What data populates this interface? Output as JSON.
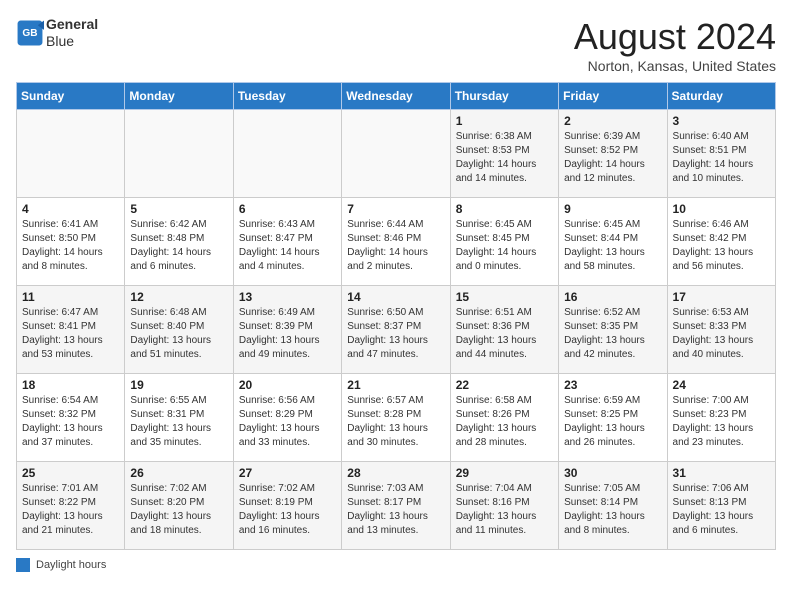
{
  "header": {
    "logo_line1": "General",
    "logo_line2": "Blue",
    "month_title": "August 2024",
    "location": "Norton, Kansas, United States"
  },
  "days_of_week": [
    "Sunday",
    "Monday",
    "Tuesday",
    "Wednesday",
    "Thursday",
    "Friday",
    "Saturday"
  ],
  "weeks": [
    [
      {
        "day": "",
        "info": ""
      },
      {
        "day": "",
        "info": ""
      },
      {
        "day": "",
        "info": ""
      },
      {
        "day": "",
        "info": ""
      },
      {
        "day": "1",
        "info": "Sunrise: 6:38 AM\nSunset: 8:53 PM\nDaylight: 14 hours and 14 minutes."
      },
      {
        "day": "2",
        "info": "Sunrise: 6:39 AM\nSunset: 8:52 PM\nDaylight: 14 hours and 12 minutes."
      },
      {
        "day": "3",
        "info": "Sunrise: 6:40 AM\nSunset: 8:51 PM\nDaylight: 14 hours and 10 minutes."
      }
    ],
    [
      {
        "day": "4",
        "info": "Sunrise: 6:41 AM\nSunset: 8:50 PM\nDaylight: 14 hours and 8 minutes."
      },
      {
        "day": "5",
        "info": "Sunrise: 6:42 AM\nSunset: 8:48 PM\nDaylight: 14 hours and 6 minutes."
      },
      {
        "day": "6",
        "info": "Sunrise: 6:43 AM\nSunset: 8:47 PM\nDaylight: 14 hours and 4 minutes."
      },
      {
        "day": "7",
        "info": "Sunrise: 6:44 AM\nSunset: 8:46 PM\nDaylight: 14 hours and 2 minutes."
      },
      {
        "day": "8",
        "info": "Sunrise: 6:45 AM\nSunset: 8:45 PM\nDaylight: 14 hours and 0 minutes."
      },
      {
        "day": "9",
        "info": "Sunrise: 6:45 AM\nSunset: 8:44 PM\nDaylight: 13 hours and 58 minutes."
      },
      {
        "day": "10",
        "info": "Sunrise: 6:46 AM\nSunset: 8:42 PM\nDaylight: 13 hours and 56 minutes."
      }
    ],
    [
      {
        "day": "11",
        "info": "Sunrise: 6:47 AM\nSunset: 8:41 PM\nDaylight: 13 hours and 53 minutes."
      },
      {
        "day": "12",
        "info": "Sunrise: 6:48 AM\nSunset: 8:40 PM\nDaylight: 13 hours and 51 minutes."
      },
      {
        "day": "13",
        "info": "Sunrise: 6:49 AM\nSunset: 8:39 PM\nDaylight: 13 hours and 49 minutes."
      },
      {
        "day": "14",
        "info": "Sunrise: 6:50 AM\nSunset: 8:37 PM\nDaylight: 13 hours and 47 minutes."
      },
      {
        "day": "15",
        "info": "Sunrise: 6:51 AM\nSunset: 8:36 PM\nDaylight: 13 hours and 44 minutes."
      },
      {
        "day": "16",
        "info": "Sunrise: 6:52 AM\nSunset: 8:35 PM\nDaylight: 13 hours and 42 minutes."
      },
      {
        "day": "17",
        "info": "Sunrise: 6:53 AM\nSunset: 8:33 PM\nDaylight: 13 hours and 40 minutes."
      }
    ],
    [
      {
        "day": "18",
        "info": "Sunrise: 6:54 AM\nSunset: 8:32 PM\nDaylight: 13 hours and 37 minutes."
      },
      {
        "day": "19",
        "info": "Sunrise: 6:55 AM\nSunset: 8:31 PM\nDaylight: 13 hours and 35 minutes."
      },
      {
        "day": "20",
        "info": "Sunrise: 6:56 AM\nSunset: 8:29 PM\nDaylight: 13 hours and 33 minutes."
      },
      {
        "day": "21",
        "info": "Sunrise: 6:57 AM\nSunset: 8:28 PM\nDaylight: 13 hours and 30 minutes."
      },
      {
        "day": "22",
        "info": "Sunrise: 6:58 AM\nSunset: 8:26 PM\nDaylight: 13 hours and 28 minutes."
      },
      {
        "day": "23",
        "info": "Sunrise: 6:59 AM\nSunset: 8:25 PM\nDaylight: 13 hours and 26 minutes."
      },
      {
        "day": "24",
        "info": "Sunrise: 7:00 AM\nSunset: 8:23 PM\nDaylight: 13 hours and 23 minutes."
      }
    ],
    [
      {
        "day": "25",
        "info": "Sunrise: 7:01 AM\nSunset: 8:22 PM\nDaylight: 13 hours and 21 minutes."
      },
      {
        "day": "26",
        "info": "Sunrise: 7:02 AM\nSunset: 8:20 PM\nDaylight: 13 hours and 18 minutes."
      },
      {
        "day": "27",
        "info": "Sunrise: 7:02 AM\nSunset: 8:19 PM\nDaylight: 13 hours and 16 minutes."
      },
      {
        "day": "28",
        "info": "Sunrise: 7:03 AM\nSunset: 8:17 PM\nDaylight: 13 hours and 13 minutes."
      },
      {
        "day": "29",
        "info": "Sunrise: 7:04 AM\nSunset: 8:16 PM\nDaylight: 13 hours and 11 minutes."
      },
      {
        "day": "30",
        "info": "Sunrise: 7:05 AM\nSunset: 8:14 PM\nDaylight: 13 hours and 8 minutes."
      },
      {
        "day": "31",
        "info": "Sunrise: 7:06 AM\nSunset: 8:13 PM\nDaylight: 13 hours and 6 minutes."
      }
    ]
  ],
  "legend": {
    "color_label": "Daylight hours"
  }
}
